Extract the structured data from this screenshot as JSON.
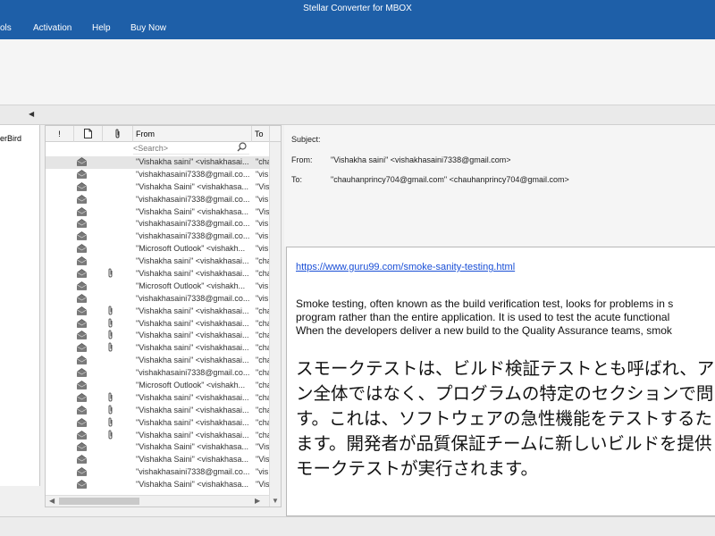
{
  "window": {
    "title": "Stellar Converter for MBOX"
  },
  "menu": {
    "items": [
      "ols",
      "Activation",
      "Help",
      "Buy Now"
    ]
  },
  "tree": {
    "item": "erBird"
  },
  "list": {
    "headers": {
      "flag": "!",
      "doc": "🗋",
      "attach": "🖇",
      "from": "From",
      "to": "To"
    },
    "search_placeholder": "<Search>",
    "rows": [
      {
        "from": "\"Vishakha saini\" <vishakhasai...",
        "to": "\"cha",
        "attach": false,
        "selected": true
      },
      {
        "from": "\"vishakhasaini7338@gmail.co...",
        "to": "\"vis",
        "attach": false
      },
      {
        "from": "\"Vishakha Saini\" <vishakhasa...",
        "to": "\"Vis",
        "attach": false
      },
      {
        "from": "\"vishakhasaini7338@gmail.co...",
        "to": "\"vis",
        "attach": false
      },
      {
        "from": "\"Vishakha Saini\" <vishakhasa...",
        "to": "\"Vis",
        "attach": false
      },
      {
        "from": "\"vishakhasaini7338@gmail.co...",
        "to": "\"vis",
        "attach": false
      },
      {
        "from": "\"vishakhasaini7338@gmail.co...",
        "to": "\"vis",
        "attach": false
      },
      {
        "from": "\"Microsoft Outlook\" <vishakh...",
        "to": "\"vis",
        "attach": false
      },
      {
        "from": "\"Vishakha saini\" <vishakhasai...",
        "to": "\"cha",
        "attach": false
      },
      {
        "from": "\"Vishakha saini\" <vishakhasai...",
        "to": "\"cha",
        "attach": true
      },
      {
        "from": "\"Microsoft Outlook\" <vishakh...",
        "to": "\"vis",
        "attach": false
      },
      {
        "from": "\"vishakhasaini7338@gmail.co...",
        "to": "\"vis",
        "attach": false
      },
      {
        "from": "\"Vishakha saini\" <vishakhasai...",
        "to": "\"cha",
        "attach": true
      },
      {
        "from": "\"Vishakha saini\" <vishakhasai...",
        "to": "\"cha",
        "attach": true
      },
      {
        "from": "\"Vishakha saini\" <vishakhasai...",
        "to": "\"cha",
        "attach": true
      },
      {
        "from": "\"Vishakha saini\" <vishakhasai...",
        "to": "\"cha",
        "attach": true
      },
      {
        "from": "\"Vishakha saini\" <vishakhasai...",
        "to": "\"cha",
        "attach": false
      },
      {
        "from": "\"vishakhasaini7338@gmail.co...",
        "to": "\"cha",
        "attach": false
      },
      {
        "from": "\"Microsoft Outlook\" <vishakh...",
        "to": "\"cha",
        "attach": false
      },
      {
        "from": "\"Vishakha saini\" <vishakhasai...",
        "to": "\"cha",
        "attach": true
      },
      {
        "from": "\"Vishakha saini\" <vishakhasai...",
        "to": "\"cha",
        "attach": true
      },
      {
        "from": "\"Vishakha saini\" <vishakhasai...",
        "to": "\"cha",
        "attach": true
      },
      {
        "from": "\"Vishakha saini\" <vishakhasai...",
        "to": "\"cha",
        "attach": true
      },
      {
        "from": "\"Vishakha Saini\" <vishakhasa...",
        "to": "\"Vis",
        "attach": false
      },
      {
        "from": "\"Vishakha Saini\" <vishakhasa...",
        "to": "\"Vis",
        "attach": false
      },
      {
        "from": "\"vishakhasaini7338@gmail.co...",
        "to": "\"vis",
        "attach": false
      },
      {
        "from": "\"Vishakha Saini\" <vishakhasa...",
        "to": "\"Vis",
        "attach": false
      }
    ]
  },
  "message": {
    "subject_label": "Subject:",
    "subject": "",
    "from_label": "From:",
    "from": "\"Vishakha saini\" <vishakhasaini7338@gmail.com>",
    "to_label": "To:",
    "to": "\"chauhanprincy704@gmail.com\" <chauhanprincy704@gmail.com>",
    "link": "https://www.guru99.com/smoke-sanity-testing.html",
    "en_lines": [
      "Smoke testing, often known as the build verification test, looks for problems in s",
      "program rather than the entire application. It is used to test the acute functional",
      "When the developers deliver a new build to the Quality Assurance teams, smok"
    ],
    "jp_lines": [
      "スモークテストは、ビルド検証テストとも呼ばれ、ア",
      "ン全体ではなく、プログラムの特定のセクションで問",
      "す。これは、ソフトウェアの急性機能をテストするた",
      "ます。開発者が品質保証チームに新しいビルドを提供",
      "モークテストが実行されます。"
    ]
  }
}
